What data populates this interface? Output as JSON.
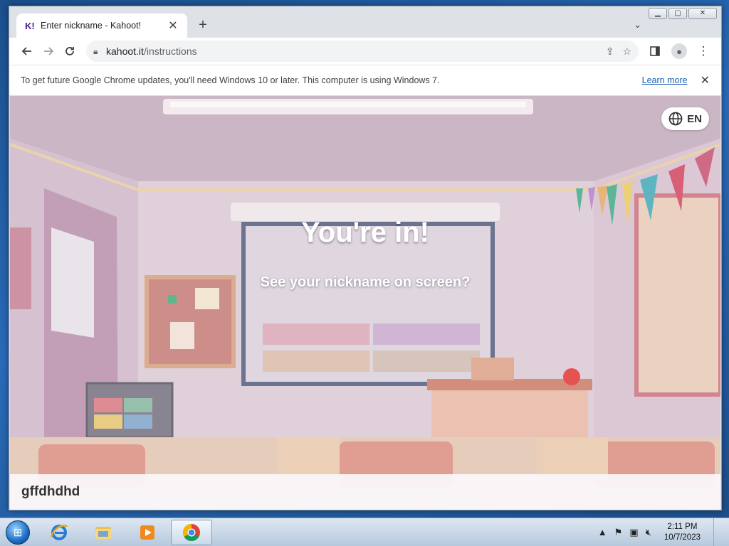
{
  "browser": {
    "tab_title": "Enter nickname - Kahoot!",
    "tab_favicon": "K!",
    "url_host": "kahoot.it",
    "url_path": "/instructions",
    "new_tab_label": "+"
  },
  "infobar": {
    "message": "To get future Google Chrome updates, you'll need Windows 10 or later. This computer is using Windows 7.",
    "link": "Learn more"
  },
  "page": {
    "language": "EN",
    "headline": "You're in!",
    "subline": "See your nickname on screen?",
    "nickname": "gffdhdhd"
  },
  "taskbar": {
    "time": "2:11 PM",
    "date": "10/7/2023",
    "apps": [
      "internet-explorer",
      "file-explorer",
      "media-player",
      "chrome"
    ]
  },
  "colors": {
    "kahoot_purple": "#46178f",
    "chrome_blue": "#1a5fb4"
  }
}
